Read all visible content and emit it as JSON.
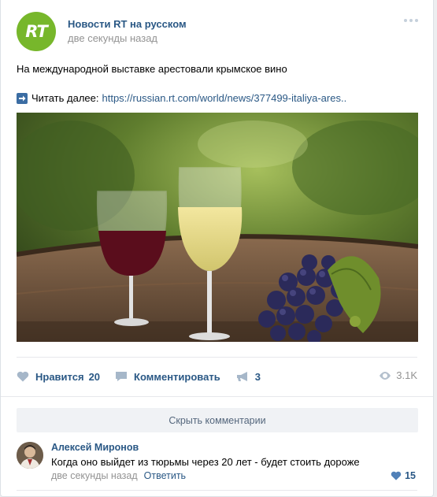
{
  "post": {
    "author": "Новости RT на русском",
    "avatar_text": "RT",
    "time": "две секунды назад",
    "text": "На международной выставке арестовали крымское вино",
    "read_more_label": "Читать далее:",
    "link": "https://russian.rt.com/world/news/377499-italiya-ares..",
    "image_alt": "wine glasses and grapes on barrel"
  },
  "actions": {
    "like_label": "Нравится",
    "like_count": "20",
    "comment_label": "Комментировать",
    "share_count": "3",
    "views": "3.1K"
  },
  "comments": {
    "hide_label": "Скрыть комментарии",
    "items": [
      {
        "author": "Алексей Миронов",
        "text": "Когда оно выйдет из тюрьмы через 20 лет - будет стоить дороже",
        "time": "две секунды назад",
        "reply_label": "Ответить",
        "likes": "15"
      }
    ]
  },
  "colors": {
    "link": "#2a5885",
    "brand_green": "#77b72b",
    "meta_gray": "#939393"
  },
  "icons": [
    "more-icon",
    "arrow-right-icon",
    "heart-icon",
    "comment-icon",
    "share-icon",
    "eye-icon"
  ]
}
